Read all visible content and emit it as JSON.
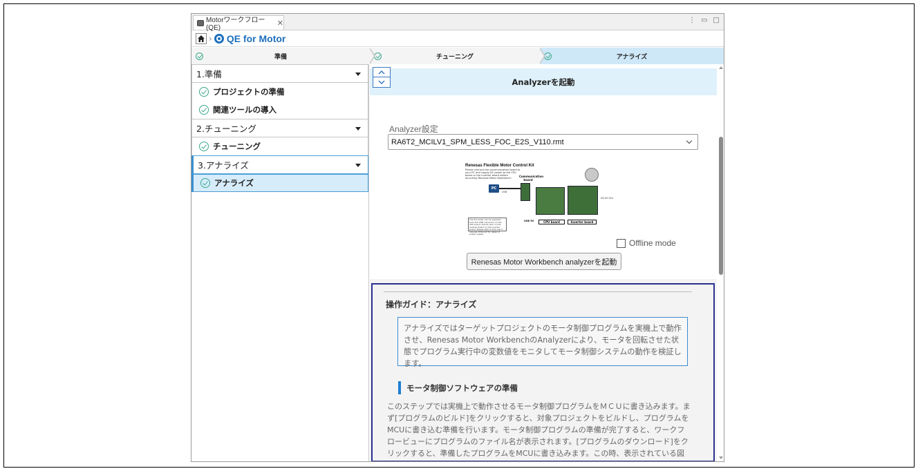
{
  "window": {
    "tab_title": "Motorワークフロー (QE)",
    "tab_close": "✕",
    "controls": [
      "⋮",
      "▭",
      "□"
    ]
  },
  "breadcrumb": {
    "crumb_separator": "›",
    "title": "QE for Motor"
  },
  "steps": [
    {
      "label": "準備"
    },
    {
      "label": "チューニング"
    },
    {
      "label": "アナライズ"
    }
  ],
  "sidebar": {
    "sections": [
      {
        "label": "1.準備",
        "items": [
          "プロジェクトの準備",
          "関連ツールの導入"
        ]
      },
      {
        "label": "2.チューニング",
        "items": [
          "チューニング"
        ]
      },
      {
        "label": "3.アナライズ",
        "items": [
          "アナライズ"
        ]
      }
    ]
  },
  "main": {
    "section_title": "Analyzerを起動",
    "settings_label": "Analyzer設定",
    "settings_value": "RA6T2_MCILV1_SPM_LESS_FOC_E2S_V110.rmt",
    "kit": {
      "title": "Renesas Flexible Motor Control Kit",
      "desc": "Please connect the communication board to your PC and supply DC power to the CPU board or the inverter board before launching Renesas Motor Workbench",
      "comm_label": "Communication board",
      "pc": "PC",
      "usb": "USB",
      "dcin": "DC-IN 24V",
      "note": "The 5V power can be supplied from the USB connector on the CPU board, the DC jack on the inverter board or the inverter board. Please refer to the user's manual of the kit for detail of power supply.",
      "usb5v": "USB 5V",
      "cpu_board": "CPU board",
      "inverter_board": "Inverter board"
    },
    "offline_label": "Offline mode",
    "launch_button": "Renesas Motor Workbench analyzerを起動"
  },
  "guide": {
    "title": "操作ガイド：アナライズ",
    "info": "アナライズではターゲットプロジェクトのモータ制御プログラムを実機上で動作させ、Renesas Motor WorkbenchのAnalyzerにより、モータを回転させた状態でプログラム実行中の変数値をモニタしてモータ制御システムの動作を検証します。",
    "subheading": "モータ制御ソフトウェアの準備",
    "body": "このステップでは実機上で動作させるモータ制御プログラムをＭＣＵに書き込みます。まず[プログラムのビルド]をクリックすると、対象プロジェクトをビルドし、プログラムをMCUに書き込む準備を行います。モータ制御プログラムの準備が完了すると、ワークフロービューにプログラムのファイル名が表示されます。[プログラムのダウンロード]をクリックすると、準備したプログラムをMCUに書き込みます。この時、表示されている図を参照しCPUボードなど"
  }
}
